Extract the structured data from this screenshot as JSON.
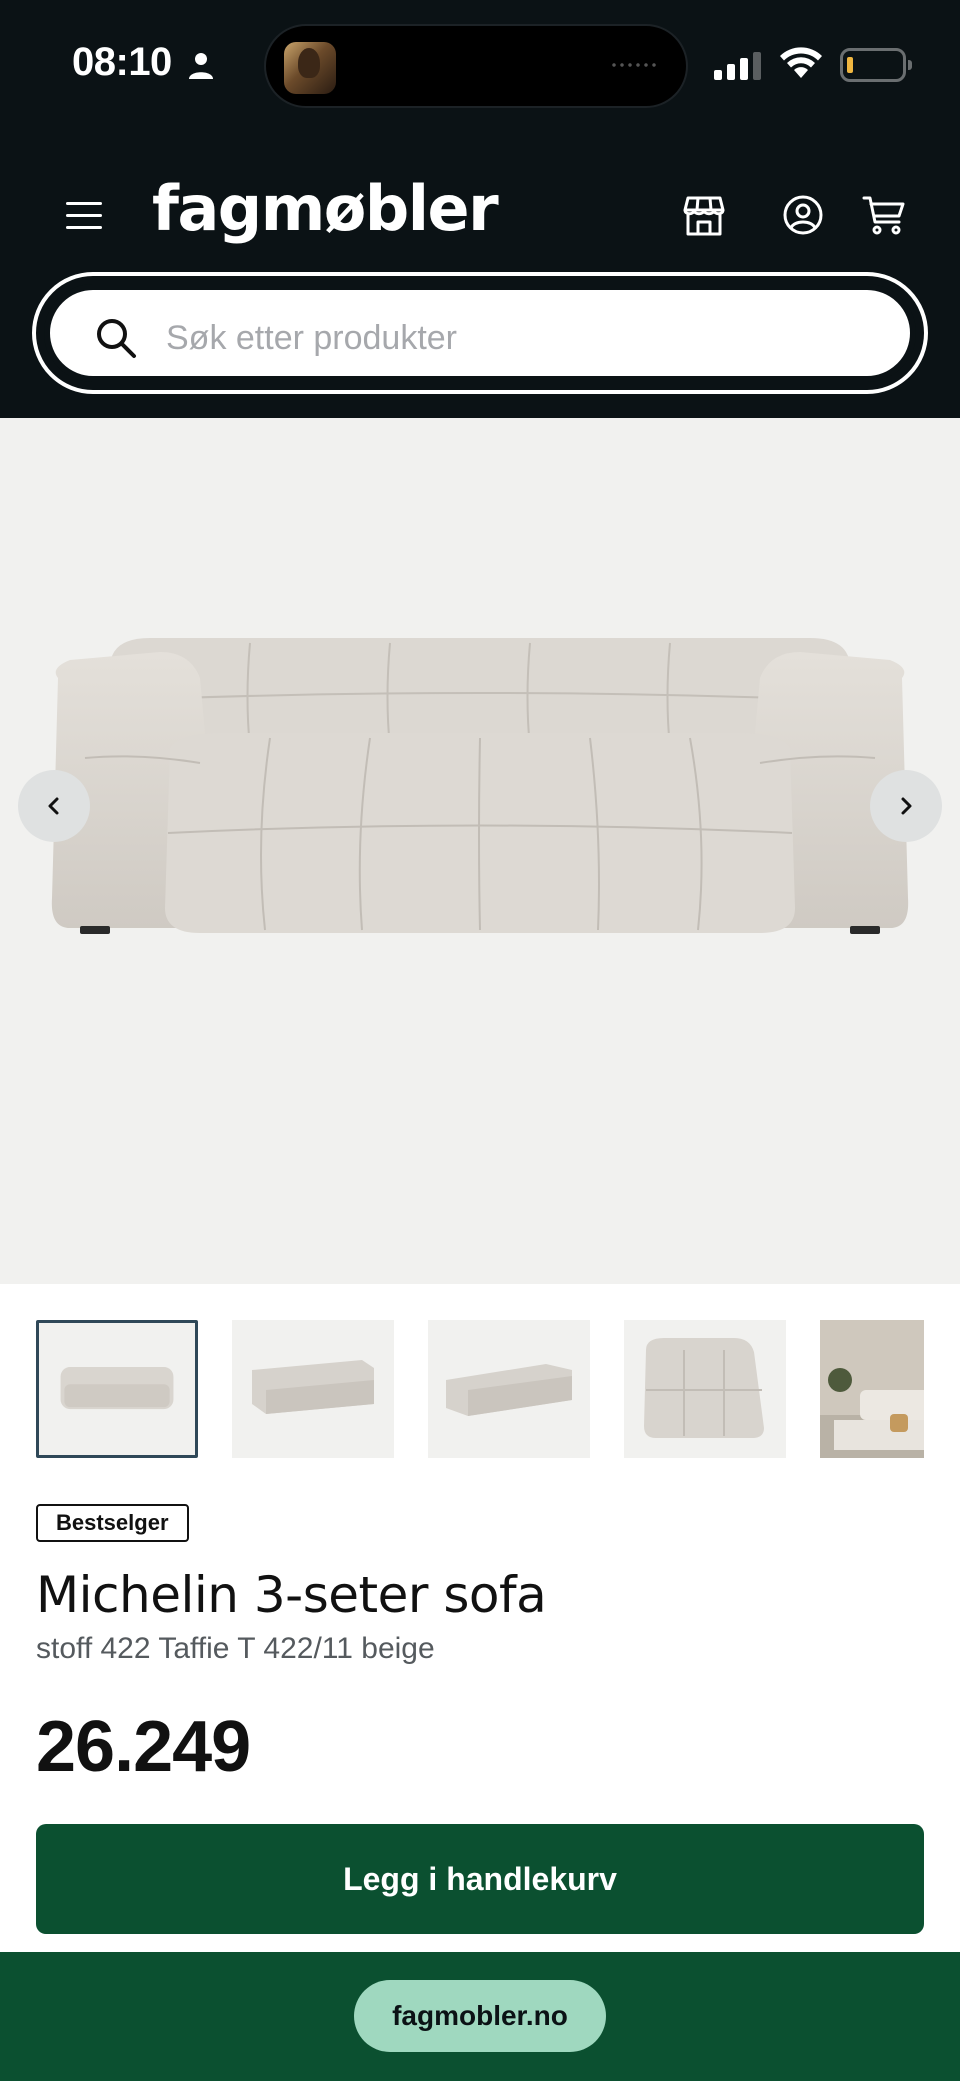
{
  "status_bar": {
    "time": "08:10"
  },
  "header": {
    "logo": "fagmøbler",
    "icons": [
      "menu-icon",
      "store-icon",
      "user-icon",
      "cart-icon"
    ]
  },
  "search": {
    "placeholder": "Søk etter produkter"
  },
  "gallery": {
    "thumbnail_count": 5,
    "active_index": 0
  },
  "product": {
    "badge": "Bestselger",
    "title": "Michelin 3-seter sofa",
    "subtitle": "stoff 422 Taffie T 422/11 beige",
    "price": "26.249",
    "add_to_cart_label": "Legg i handlekurv"
  },
  "browser": {
    "url": "fagmobler.no"
  },
  "colors": {
    "header_bg": "#0b1215",
    "brand_green": "#0b5030",
    "url_pill": "#9fd8bf",
    "hero_bg": "#f1f1ef"
  }
}
